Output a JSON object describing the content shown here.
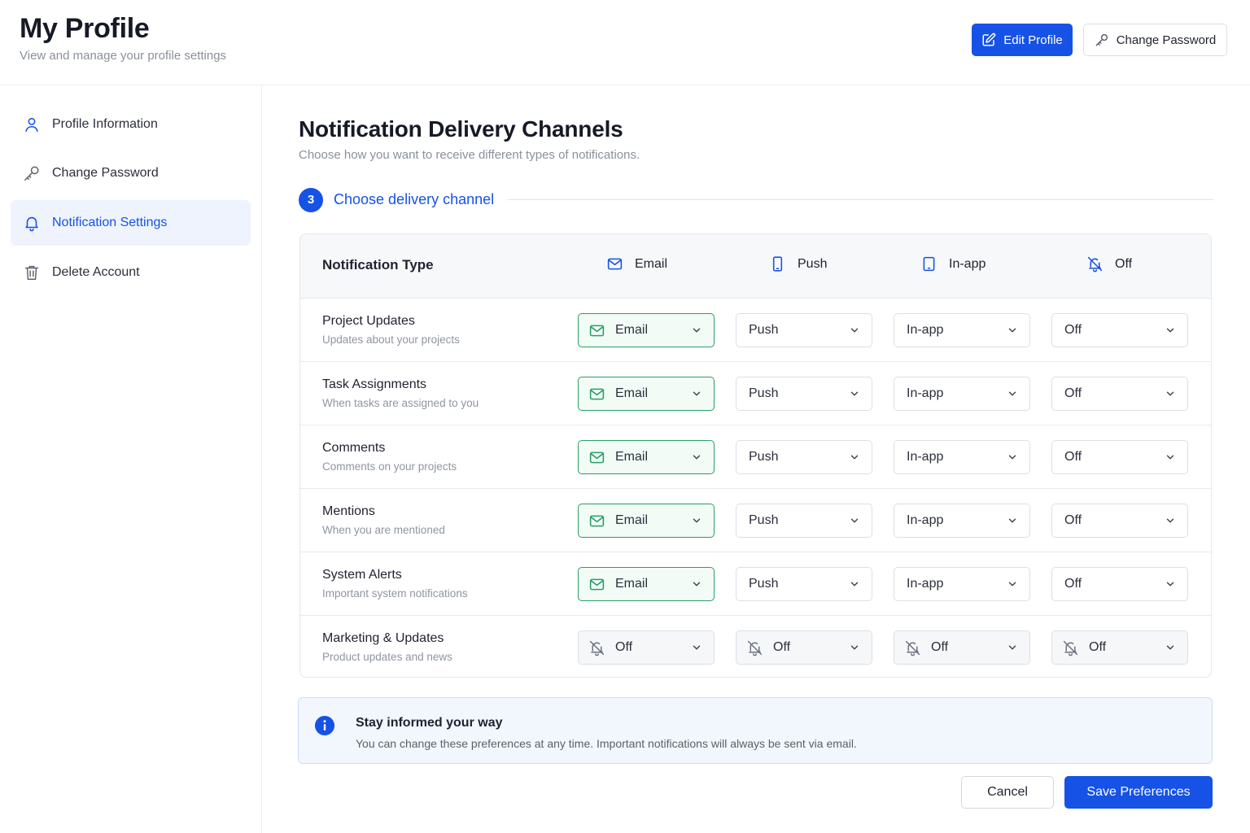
{
  "header": {
    "title": "My Profile",
    "subtitle": "View and manage your profile settings",
    "edit_profile_label": "Edit Profile",
    "change_password_label": "Change Password"
  },
  "sidebar": {
    "items": [
      {
        "label": "Profile Information",
        "icon": "user-icon",
        "active": false
      },
      {
        "label": "Change Password",
        "icon": "key-icon",
        "active": false
      },
      {
        "label": "Notification Settings",
        "icon": "bell-icon",
        "active": true
      },
      {
        "label": "Delete Account",
        "icon": "trash-icon",
        "active": false
      }
    ]
  },
  "main": {
    "title": "Notification Delivery Channels",
    "subtitle": "Choose how you want to receive different types of notifications.",
    "step": {
      "number": "3",
      "label": "Choose delivery channel"
    },
    "table": {
      "header_type": "Notification Type",
      "columns": [
        {
          "label": "Email",
          "icon": "mail-icon"
        },
        {
          "label": "Push",
          "icon": "phone-icon"
        },
        {
          "label": "In-app",
          "icon": "tablet-icon"
        },
        {
          "label": "Off",
          "icon": "bell-off-icon"
        }
      ],
      "rows": [
        {
          "title": "Project Updates",
          "desc": "Updates about your projects",
          "values": [
            "Email",
            "Push",
            "In-app",
            "Off"
          ]
        },
        {
          "title": "Task Assignments",
          "desc": "When tasks are assigned to you",
          "values": [
            "Email",
            "Push",
            "In-app",
            "Off"
          ]
        },
        {
          "title": "Comments",
          "desc": "Comments on your projects",
          "values": [
            "Email",
            "Push",
            "In-app",
            "Off"
          ]
        },
        {
          "title": "Mentions",
          "desc": "When you are mentioned",
          "values": [
            "Email",
            "Push",
            "In-app",
            "Off"
          ]
        },
        {
          "title": "System Alerts",
          "desc": "Important system notifications",
          "values": [
            "Email",
            "Push",
            "In-app",
            "Off"
          ]
        },
        {
          "title": "Marketing & Updates",
          "desc": "Product updates and news",
          "values": [
            "Off",
            "Off",
            "Off",
            "Off"
          ]
        }
      ]
    },
    "info": {
      "title": "Stay informed your way",
      "text": "You can change these preferences at any time. Important notifications will always be sent via email."
    },
    "cancel_label": "Cancel",
    "save_label": "Save Preferences"
  },
  "colors": {
    "accent": "#1652e6",
    "success": "#25a165",
    "active_bg": "#eef3fd",
    "info_bg": "#f2f6fd"
  }
}
